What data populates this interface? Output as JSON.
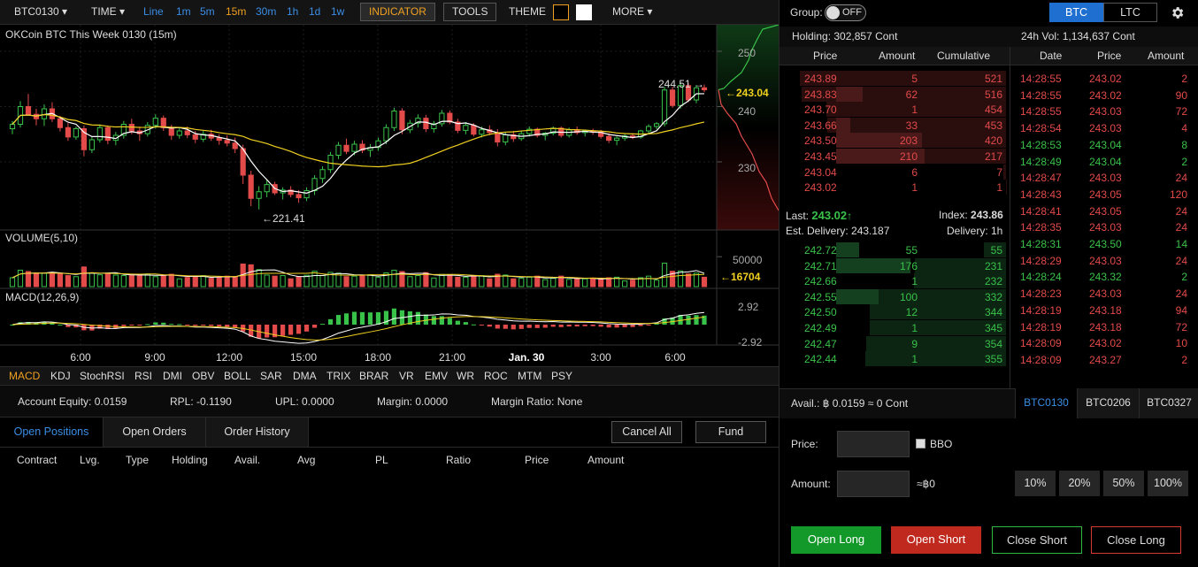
{
  "topbar": {
    "symbol": "BTC0130 ▾",
    "time": "TIME ▾",
    "timeframes": [
      "Line",
      "1m",
      "5m",
      "15m",
      "30m",
      "1h",
      "1d",
      "1w"
    ],
    "selected_timeframe": "15m",
    "indicator": "INDICATOR",
    "tools": "TOOLS",
    "theme": "THEME",
    "more": "MORE ▾"
  },
  "chart": {
    "title": "OKCoin BTC This Week 0130 (15m)",
    "price_ticks": [
      "250",
      "240",
      "230"
    ],
    "last_price_label": "243.04",
    "high_label": "244.51 →",
    "low_label": "←221.41",
    "volume_title": "VOLUME(5,10)",
    "volume_ticks": [
      "50000"
    ],
    "volume_last": "16704",
    "macd_title": "MACD(12,26,9)",
    "macd_ticks": [
      "2.92",
      "-2.92"
    ],
    "time_ticks": [
      "6:00",
      "9:00",
      "12:00",
      "15:00",
      "18:00",
      "21:00",
      "Jan. 30",
      "3:00",
      "6:00"
    ]
  },
  "chart_data": {
    "type": "candlestick",
    "price_range": [
      218,
      254
    ],
    "candles": [
      [
        236.0,
        237.4,
        235.0,
        236.8
      ],
      [
        236.8,
        241.0,
        236.2,
        240.0
      ],
      [
        240.0,
        242.3,
        238.4,
        238.6
      ],
      [
        238.6,
        239.6,
        236.6,
        237.8
      ],
      [
        237.8,
        240.4,
        236.5,
        239.6
      ],
      [
        239.6,
        240.8,
        237.2,
        237.8
      ],
      [
        237.8,
        238.3,
        235.5,
        236.2
      ],
      [
        236.2,
        237.0,
        233.8,
        234.5
      ],
      [
        234.5,
        236.4,
        234.0,
        236.0
      ],
      [
        236.0,
        236.6,
        231.0,
        232.2
      ],
      [
        232.2,
        234.6,
        231.6,
        234.0
      ],
      [
        234.0,
        236.8,
        233.5,
        236.2
      ],
      [
        236.2,
        236.6,
        233.2,
        233.9
      ],
      [
        233.9,
        235.4,
        233.0,
        234.8
      ],
      [
        234.8,
        237.4,
        234.2,
        236.8
      ],
      [
        236.8,
        237.8,
        235.0,
        235.6
      ],
      [
        235.6,
        236.4,
        233.8,
        235.1
      ],
      [
        235.1,
        237.2,
        234.6,
        236.6
      ],
      [
        236.6,
        238.6,
        236.0,
        237.9
      ],
      [
        237.9,
        238.4,
        235.6,
        236.2
      ],
      [
        236.2,
        236.7,
        234.0,
        234.8
      ],
      [
        234.8,
        236.2,
        234.2,
        235.6
      ],
      [
        235.6,
        236.4,
        234.3,
        234.9
      ],
      [
        234.9,
        235.6,
        233.4,
        234.1
      ],
      [
        234.1,
        235.6,
        233.6,
        235.0
      ],
      [
        235.0,
        235.8,
        233.8,
        234.3
      ],
      [
        234.3,
        235.0,
        233.1,
        233.9
      ],
      [
        233.9,
        234.8,
        232.8,
        233.4
      ],
      [
        233.4,
        234.4,
        231.6,
        232.4
      ],
      [
        232.4,
        233.1,
        226.0,
        227.6
      ],
      [
        227.6,
        228.4,
        222.0,
        223.4
      ],
      [
        223.4,
        225.6,
        221.4,
        224.6
      ],
      [
        224.6,
        226.8,
        223.6,
        225.9
      ],
      [
        225.9,
        226.4,
        224.0,
        224.4
      ],
      [
        224.4,
        225.4,
        223.2,
        224.9
      ],
      [
        224.9,
        225.6,
        223.6,
        224.1
      ],
      [
        224.1,
        224.9,
        222.6,
        223.5
      ],
      [
        223.5,
        225.4,
        222.9,
        224.8
      ],
      [
        224.8,
        227.6,
        224.0,
        227.0
      ],
      [
        227.0,
        229.2,
        226.2,
        228.6
      ],
      [
        228.6,
        231.8,
        228.0,
        231.2
      ],
      [
        231.2,
        233.6,
        230.5,
        233.0
      ],
      [
        233.0,
        234.2,
        231.4,
        231.9
      ],
      [
        231.9,
        233.8,
        231.2,
        233.2
      ],
      [
        233.2,
        233.9,
        231.6,
        232.1
      ],
      [
        232.1,
        233.2,
        230.9,
        232.6
      ],
      [
        232.6,
        234.4,
        232.0,
        233.8
      ],
      [
        233.8,
        236.8,
        233.2,
        236.2
      ],
      [
        236.2,
        239.8,
        235.6,
        239.2
      ],
      [
        239.2,
        239.7,
        235.0,
        235.8
      ],
      [
        235.8,
        237.6,
        235.2,
        237.0
      ],
      [
        237.0,
        238.6,
        236.2,
        237.9
      ],
      [
        237.9,
        238.5,
        235.4,
        236.0
      ],
      [
        236.0,
        237.4,
        235.3,
        236.9
      ],
      [
        236.9,
        239.4,
        236.4,
        238.8
      ],
      [
        238.8,
        239.3,
        236.8,
        237.2
      ],
      [
        237.2,
        237.8,
        235.2,
        235.7
      ],
      [
        235.7,
        237.2,
        235.0,
        236.6
      ],
      [
        236.6,
        237.0,
        234.6,
        235.0
      ],
      [
        235.0,
        236.4,
        234.4,
        235.8
      ],
      [
        235.8,
        236.6,
        234.8,
        235.3
      ],
      [
        235.3,
        235.9,
        232.8,
        233.6
      ],
      [
        233.6,
        235.4,
        233.0,
        234.9
      ],
      [
        234.9,
        235.6,
        233.6,
        234.2
      ],
      [
        234.2,
        235.6,
        233.8,
        235.1
      ],
      [
        235.1,
        236.4,
        234.6,
        235.9
      ],
      [
        235.9,
        236.2,
        234.4,
        234.8
      ],
      [
        234.8,
        235.4,
        233.9,
        235.2
      ],
      [
        235.2,
        236.4,
        234.8,
        236.1
      ],
      [
        236.1,
        236.4,
        234.4,
        234.8
      ],
      [
        234.8,
        236.2,
        234.4,
        235.8
      ],
      [
        235.8,
        236.4,
        234.9,
        235.3
      ],
      [
        235.3,
        235.8,
        234.6,
        235.6
      ],
      [
        235.6,
        236.0,
        234.9,
        235.4
      ],
      [
        235.4,
        235.8,
        234.2,
        234.6
      ],
      [
        234.6,
        235.2,
        233.4,
        233.9
      ],
      [
        233.9,
        234.6,
        233.0,
        234.3
      ],
      [
        234.3,
        235.0,
        233.8,
        234.7
      ],
      [
        234.7,
        235.2,
        234.1,
        234.5
      ],
      [
        234.5,
        235.8,
        234.2,
        235.6
      ],
      [
        235.6,
        236.8,
        235.0,
        236.4
      ],
      [
        236.4,
        237.2,
        235.9,
        236.9
      ],
      [
        236.9,
        243.6,
        236.4,
        243.0
      ],
      [
        243.0,
        243.6,
        239.8,
        240.2
      ],
      [
        240.2,
        244.5,
        239.6,
        243.8
      ],
      [
        243.8,
        244.2,
        240.8,
        241.2
      ],
      [
        241.2,
        243.9,
        240.6,
        243.4
      ],
      [
        243.4,
        244.0,
        242.6,
        243.04
      ]
    ],
    "volume_range": [
      0,
      68000
    ],
    "macd_range": [
      -3.2,
      3.2
    ],
    "series": [
      {
        "name": "MA"
      },
      {
        "name": "MA"
      }
    ],
    "last": 243.04
  },
  "indicator_bar": [
    "MACD",
    "KDJ",
    "StochRSI",
    "RSI",
    "DMI",
    "OBV",
    "BOLL",
    "SAR",
    "DMA",
    "TRIX",
    "BRAR",
    "VR",
    "EMV",
    "WR",
    "ROC",
    "MTM",
    "PSY"
  ],
  "account": {
    "equity": "Account Equity: 0.0159",
    "rpl": "RPL: -0.1190",
    "upl": "UPL: 0.0000",
    "margin": "Margin: 0.0000",
    "margin_ratio": "Margin Ratio: None"
  },
  "tabs": [
    "Open Positions",
    "Open Orders",
    "Order History"
  ],
  "cancel_all": "Cancel All",
  "fund": "Fund",
  "positions_columns": [
    "Contract",
    "Lvg.",
    "Type",
    "Holding",
    "Avail.",
    "Avg",
    "PL",
    "Ratio",
    "Price",
    "Amount"
  ],
  "right": {
    "group_label": "Group:",
    "group_toggle": "OFF",
    "coin_tabs": [
      "BTC",
      "LTC"
    ],
    "holding": "Holding: 302,857 Cont",
    "vol24": "24h Vol: 1,134,637 Cont",
    "book_headers": [
      "Price",
      "Amount",
      "Cumulative"
    ],
    "asks": [
      [
        "243.89",
        "5",
        "521"
      ],
      [
        "243.83",
        "62",
        "516"
      ],
      [
        "243.70",
        "1",
        "454"
      ],
      [
        "243.66",
        "33",
        "453"
      ],
      [
        "243.50",
        "203",
        "420"
      ],
      [
        "243.45",
        "210",
        "217"
      ],
      [
        "243.04",
        "6",
        "7"
      ],
      [
        "243.02",
        "1",
        "1"
      ]
    ],
    "last_label": "Last:",
    "last_value": "243.02",
    "index_label": "Index:",
    "index_value": "243.86",
    "est_delivery": "Est. Delivery: 243.187",
    "delivery": "Delivery: 1h",
    "bids": [
      [
        "242.72",
        "55",
        "55"
      ],
      [
        "242.71",
        "176",
        "231"
      ],
      [
        "242.66",
        "1",
        "232"
      ],
      [
        "242.55",
        "100",
        "332"
      ],
      [
        "242.50",
        "12",
        "344"
      ],
      [
        "242.49",
        "1",
        "345"
      ],
      [
        "242.47",
        "9",
        "354"
      ],
      [
        "242.44",
        "1",
        "355"
      ]
    ],
    "trade_headers": [
      "Date",
      "Price",
      "Amount"
    ],
    "trades": [
      [
        "14:28:55",
        "243.02",
        "2",
        "r"
      ],
      [
        "14:28:55",
        "243.02",
        "90",
        "r"
      ],
      [
        "14:28:55",
        "243.03",
        "72",
        "r"
      ],
      [
        "14:28:54",
        "243.03",
        "4",
        "r"
      ],
      [
        "14:28:53",
        "243.04",
        "8",
        "g"
      ],
      [
        "14:28:49",
        "243.04",
        "2",
        "g"
      ],
      [
        "14:28:47",
        "243.03",
        "24",
        "r"
      ],
      [
        "14:28:43",
        "243.05",
        "120",
        "r"
      ],
      [
        "14:28:41",
        "243.05",
        "24",
        "r"
      ],
      [
        "14:28:35",
        "243.03",
        "24",
        "r"
      ],
      [
        "14:28:31",
        "243.50",
        "14",
        "g"
      ],
      [
        "14:28:29",
        "243.03",
        "24",
        "r"
      ],
      [
        "14:28:24",
        "243.32",
        "2",
        "g"
      ],
      [
        "14:28:23",
        "243.03",
        "24",
        "r"
      ],
      [
        "14:28:19",
        "243.18",
        "94",
        "r"
      ],
      [
        "14:28:19",
        "243.18",
        "72",
        "r"
      ],
      [
        "14:28:09",
        "243.02",
        "10",
        "r"
      ],
      [
        "14:28:09",
        "243.27",
        "2",
        "r"
      ]
    ],
    "avail": "Avail.: ฿ 0.0159 ≈ 0 Cont",
    "contract_tabs": [
      "BTC0130",
      "BTC0206",
      "BTC0327"
    ],
    "price_label": "Price:",
    "bbo": "BBO",
    "amount_label": "Amount:",
    "approx": "≈฿0",
    "percent_buttons": [
      "10%",
      "20%",
      "50%",
      "100%"
    ],
    "open_long": "Open Long",
    "open_short": "Open Short",
    "close_short": "Close Short",
    "close_long": "Close Long"
  },
  "colors": {
    "up": "#39c24a",
    "down": "#e34a4a",
    "accent": "#3a8ee6",
    "orange": "#f0a020"
  }
}
